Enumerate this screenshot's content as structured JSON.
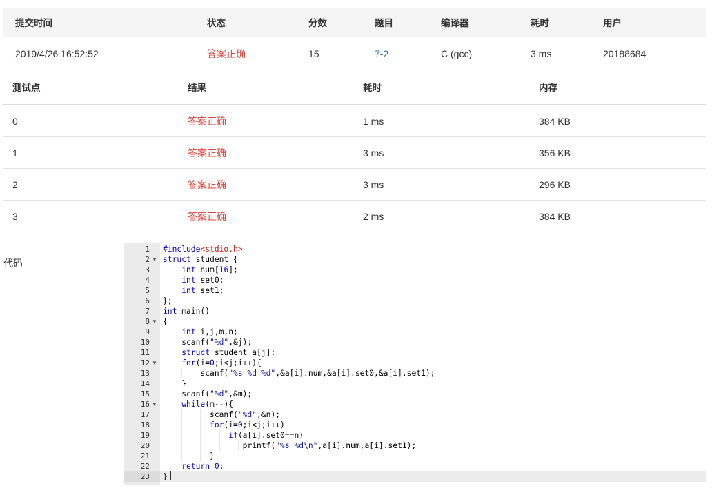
{
  "summary": {
    "headers": [
      "提交时间",
      "状态",
      "分数",
      "题目",
      "编译器",
      "耗时",
      "用户"
    ],
    "row": {
      "time": "2019/4/26 16:52:52",
      "status": "答案正确",
      "score": "15",
      "problem": "7-2",
      "compiler": "C (gcc)",
      "duration": "3 ms",
      "user": "20188684"
    }
  },
  "cases": {
    "headers": [
      "测试点",
      "结果",
      "耗时",
      "内存"
    ],
    "rows": [
      {
        "id": "0",
        "result": "答案正确",
        "time": "1 ms",
        "memory": "384 KB"
      },
      {
        "id": "1",
        "result": "答案正确",
        "time": "3 ms",
        "memory": "356 KB"
      },
      {
        "id": "2",
        "result": "答案正确",
        "time": "3 ms",
        "memory": "296 KB"
      },
      {
        "id": "3",
        "result": "答案正确",
        "time": "2 ms",
        "memory": "384 KB"
      }
    ]
  },
  "code_label": "代码",
  "code_lines": [
    "#include<stdio.h>",
    "struct student {",
    "    int num[16];",
    "    int set0;",
    "    int set1;",
    "};",
    "int main()",
    "{",
    "    int i,j,m,n;",
    "    scanf(\"%d\",&j);",
    "    struct student a[j];",
    "    for(i=0;i<j;i++){",
    "        scanf(\"%s %d %d\",&a[i].num,&a[i].set0,&a[i].set1);",
    "    }",
    "    scanf(\"%d\",&m);",
    "    while(m--){",
    "          scanf(\"%d\",&n);",
    "          for(i=0;i<j;i++)",
    "              if(a[i].set0==n)",
    "                 printf(\"%s %d\\n\",a[i].num,a[i].set1);",
    "          }",
    "    return 0;",
    "}"
  ],
  "fold_lines": [
    2,
    8,
    12,
    16
  ],
  "active_line": 23,
  "colors": {
    "status_ok": "#e0443c",
    "link": "#2d73b9",
    "keyword": "#0000cc",
    "string": "#1a1aa6",
    "include": "#c41a16"
  }
}
